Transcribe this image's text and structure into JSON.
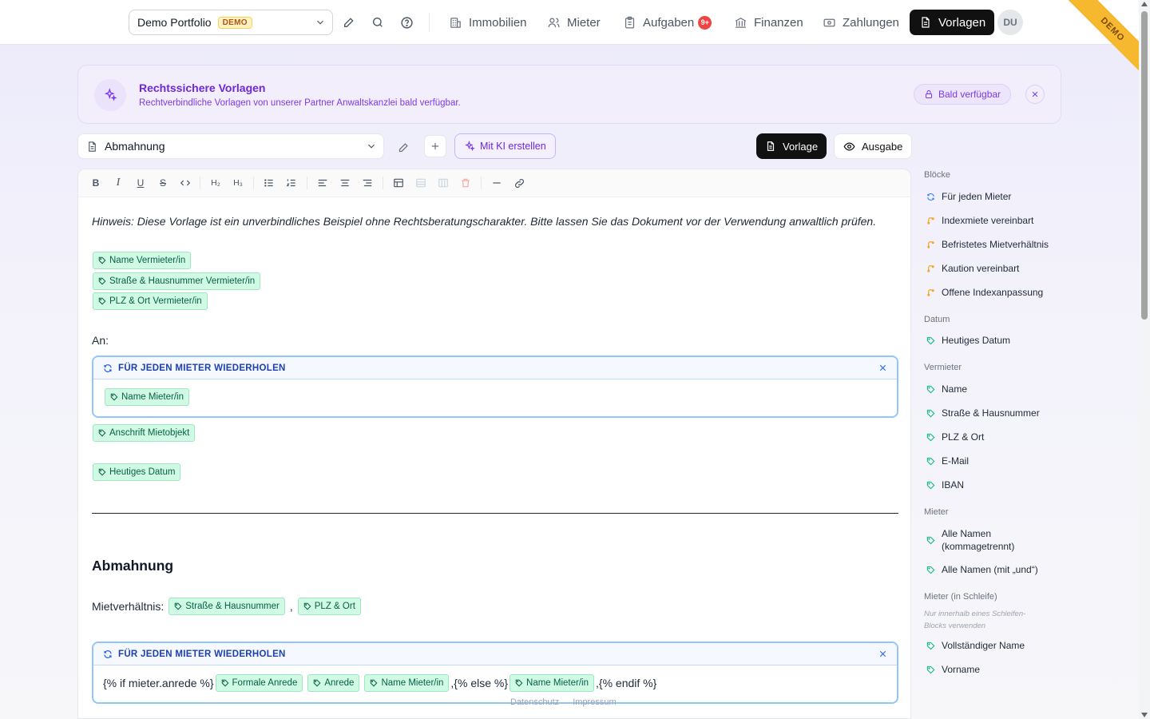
{
  "topbar": {
    "portfolio": "Demo Portfolio",
    "portfolio_badge": "DEMO",
    "nav": [
      {
        "label": "Immobilien"
      },
      {
        "label": "Mieter"
      },
      {
        "label": "Aufgaben",
        "badge": "9+"
      },
      {
        "label": "Finanzen"
      },
      {
        "label": "Zahlungen"
      },
      {
        "label": "Vorlagen",
        "active": true
      }
    ],
    "avatar": "DU",
    "ribbon": "DEMO"
  },
  "banner": {
    "title": "Rechtssichere Vorlagen",
    "subtitle": "Rechtverbindliche Vorlagen von unserer Partner Anwaltskanzlei bald verfügbar.",
    "pill": "Bald verfügbar"
  },
  "template_bar": {
    "selected": "Abmahnung",
    "ki_button": "Mit KI erstellen",
    "view_template": "Vorlage",
    "view_output": "Ausgabe"
  },
  "editor": {
    "hint": "Hinweis: Diese Vorlage ist ein unverbindliches Beispiel ohne Rechtsberatungscharakter. Bitte lassen Sie das Dokument vor der Verwendung anwaltlich prüfen.",
    "landlord_chips": [
      "Name Vermieter/in",
      "Straße & Hausnummer Vermieter/in",
      "PLZ & Ort Vermieter/in"
    ],
    "to_label": "An:",
    "loop_title": "FÜR JEDEN MIETER WIEDERHOLEN",
    "loop1_chip": "Name Mieter/in",
    "address_chip": "Anschrift Mietobjekt",
    "date_chip": "Heutiges Datum",
    "heading": "Abmahnung",
    "tenancy_label": "Mietverhältnis:",
    "tenancy_chip1": "Straße & Hausnummer",
    "tenancy_sep": ",",
    "tenancy_chip2": "PLZ & Ort",
    "loop2": {
      "if_text": "{% if mieter.anrede %}",
      "chip_formal": "Formale Anrede",
      "chip_anrede": "Anrede",
      "chip_name1": "Name Mieter/in",
      "else_text": ",{% else %}",
      "chip_name2": "Name Mieter/in",
      "endif_text": ",{% endif %}"
    }
  },
  "footer": {
    "privacy": "Datenschutz",
    "imprint": "Impressum"
  },
  "sidebar": {
    "blocks_title": "Blöcke",
    "blocks": [
      "Für jeden Mieter",
      "Indexmiete vereinbart",
      "Befristetes Mietverhältnis",
      "Kaution vereinbart",
      "Offene Indexanpassung"
    ],
    "date_title": "Datum",
    "date_items": [
      "Heutiges Datum"
    ],
    "landlord_title": "Vermieter",
    "landlord_items": [
      "Name",
      "Straße & Hausnummer",
      "PLZ & Ort",
      "E-Mail",
      "IBAN"
    ],
    "tenant_title": "Mieter",
    "tenant_items": [
      "Alle Namen (kommagetrennt)",
      "Alle Namen (mit „und“)"
    ],
    "loop_title": "Mieter (in Schleife)",
    "loop_note": "Nur innerhalb eines Schleifen-Blocks verwenden",
    "loop_items": [
      "Vollständiger Name",
      "Vorname"
    ]
  }
}
